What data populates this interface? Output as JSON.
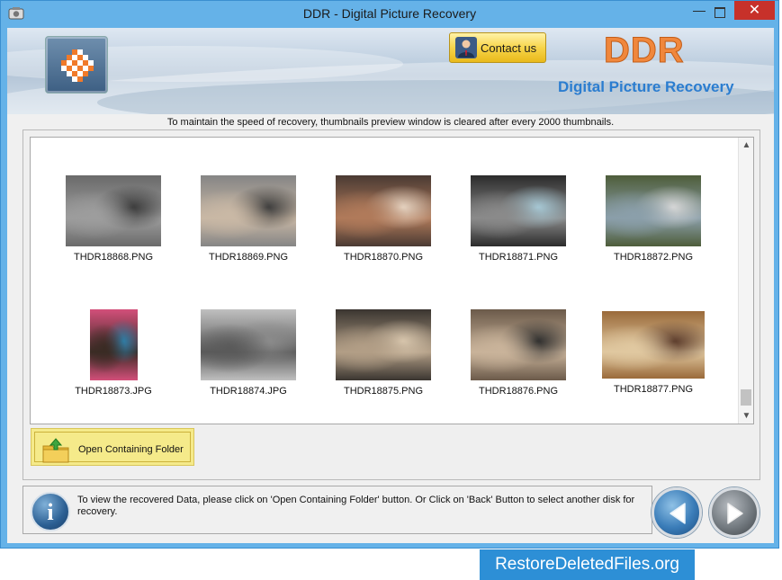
{
  "window": {
    "title": "DDR - Digital Picture Recovery",
    "minimize": "—",
    "close": "✕"
  },
  "header": {
    "contact_label": "Contact us",
    "brand": "DDR",
    "subtitle": "Digital Picture Recovery"
  },
  "notice": "To maintain the speed of recovery, thumbnails preview window is cleared after every 2000 thumbnails.",
  "thumbnails": [
    {
      "name": "THDR18868.PNG",
      "colors": [
        "#6a6a6a",
        "#9d9d9d",
        "#3a3a3a"
      ]
    },
    {
      "name": "THDR18869.PNG",
      "colors": [
        "#858585",
        "#c9b8a5",
        "#3b3b3b"
      ]
    },
    {
      "name": "THDR18870.PNG",
      "colors": [
        "#4a3a33",
        "#b07a5a",
        "#e6d4c2"
      ]
    },
    {
      "name": "THDR18871.PNG",
      "colors": [
        "#2b2b2b",
        "#8a8a8a",
        "#a7c9d6"
      ]
    },
    {
      "name": "THDR18872.PNG",
      "colors": [
        "#4e5d3a",
        "#8b9faa",
        "#d8d8d8"
      ]
    },
    {
      "name": "THDR18873.JPG",
      "colors": [
        "#d34f7a",
        "#3a2b24",
        "#2e7fa8"
      ]
    },
    {
      "name": "THDR18874.JPG",
      "colors": [
        "#c0c0c0",
        "#5a5a5a",
        "#8c8c8c"
      ]
    },
    {
      "name": "THDR18875.PNG",
      "colors": [
        "#3a3530",
        "#b29e86",
        "#d8c6ad"
      ]
    },
    {
      "name": "THDR18876.PNG",
      "colors": [
        "#6b5a4a",
        "#c9b39a",
        "#2c2c2c"
      ]
    },
    {
      "name": "THDR18877.PNG",
      "colors": [
        "#9a6a3a",
        "#e0c8a0",
        "#5a3a2a"
      ]
    }
  ],
  "open_folder_label": "Open Containing Folder",
  "info_text": "To view the recovered Data, please click on 'Open Containing Folder' button. Or Click on 'Back' Button to select another disk for recovery.",
  "info_icon_glyph": "i",
  "footer": "RestoreDeletedFiles.org",
  "colors": {
    "accent": "#2b7dd0",
    "brand": "#f0873c",
    "close": "#c7312a"
  }
}
